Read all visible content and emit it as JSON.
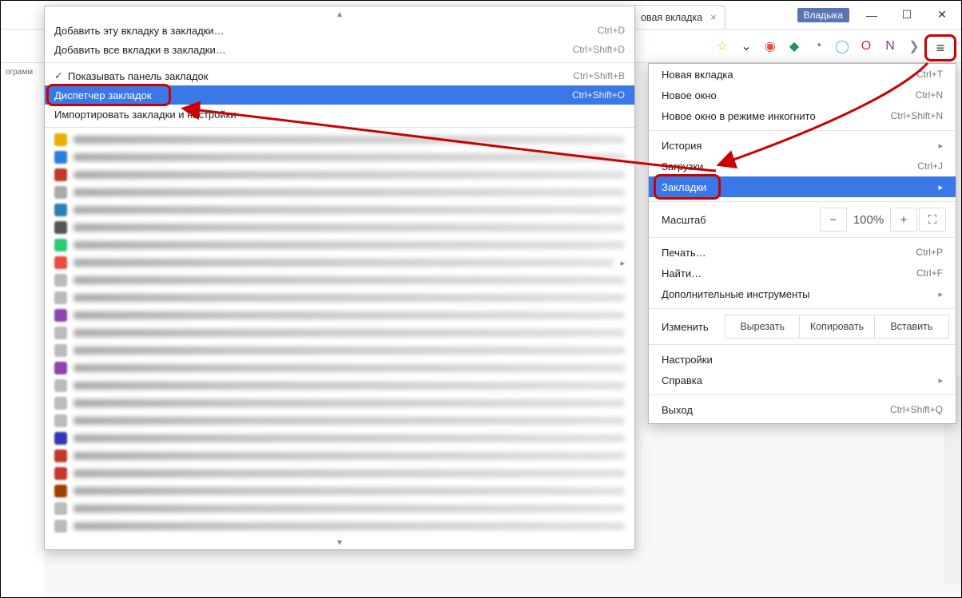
{
  "chrome": {
    "tab_title": "овая вкладка",
    "user_label": "Владыка"
  },
  "submenu": {
    "add_this": "Добавить эту вкладку в закладки…",
    "add_this_sc": "Ctrl+D",
    "add_all": "Добавить все вкладки в закладки…",
    "add_all_sc": "Ctrl+Shift+D",
    "show_bar": "Показывать панель закладок",
    "show_bar_sc": "Ctrl+Shift+B",
    "manager": "Диспетчер закладок",
    "manager_sc": "Ctrl+Shift+O",
    "import_row": "Импортировать закладки и настройки"
  },
  "mainmenu": {
    "new_tab": "Новая вкладка",
    "new_tab_sc": "Ctrl+T",
    "new_win": "Новое окно",
    "new_win_sc": "Ctrl+N",
    "incog": "Новое окно в режиме инкогнито",
    "incog_sc": "Ctrl+Shift+N",
    "history": "История",
    "downloads": "Загрузки",
    "downloads_sc": "Ctrl+J",
    "bookmarks": "Закладки",
    "zoom_label": "Масштаб",
    "zoom_value": "100%",
    "print": "Печать…",
    "print_sc": "Ctrl+P",
    "find": "Найти…",
    "find_sc": "Ctrl+F",
    "more_tools": "Дополнительные инструменты",
    "edit_label": "Изменить",
    "cut": "Вырезать",
    "copy": "Копировать",
    "paste": "Вставить",
    "settings": "Настройки",
    "help": "Справка",
    "quit": "Выход",
    "quit_sc": "Ctrl+Shift+Q"
  },
  "sidebar": {
    "truncated": "ограмм"
  }
}
